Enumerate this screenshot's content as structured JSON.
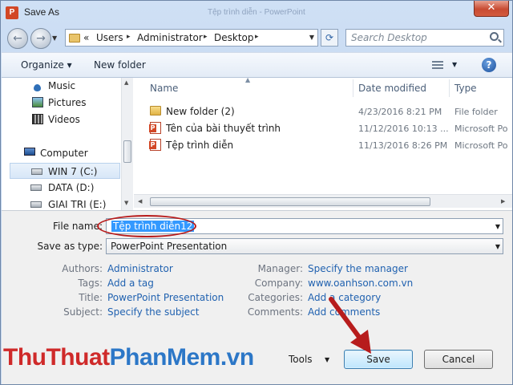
{
  "window": {
    "title": "Save As",
    "ghost_title": "Tệp trình diễn - PowerPoint",
    "close_glyph": "✕",
    "app_icon_glyph": "P"
  },
  "nav": {
    "back_glyph": "←",
    "forward_glyph": "→",
    "chevrons": "«",
    "crumbs": [
      "Users",
      "Administrator",
      "Desktop"
    ],
    "sep_glyph": "▸",
    "refresh_glyph": "⟳",
    "search_placeholder": "Search Desktop"
  },
  "toolbar": {
    "organize_label": "Organize ▾",
    "new_folder_label": "New folder",
    "help_glyph": "?"
  },
  "sidebar": {
    "items": [
      {
        "label": "Music",
        "icon": "music-icon"
      },
      {
        "label": "Pictures",
        "icon": "pictures-icon"
      },
      {
        "label": "Videos",
        "icon": "videos-icon"
      },
      {
        "label": "Computer",
        "icon": "computer-icon"
      },
      {
        "label": "WIN 7 (C:)",
        "icon": "drive-icon"
      },
      {
        "label": "DATA (D:)",
        "icon": "drive-icon"
      },
      {
        "label": "GIAI TRI (E:)",
        "icon": "drive-icon"
      }
    ]
  },
  "files": {
    "columns": [
      "Name",
      "Date modified",
      "Type"
    ],
    "rows": [
      {
        "name": "New folder (2)",
        "date": "4/23/2016 8:21 PM",
        "type": "File folder",
        "icon": "folder-icon"
      },
      {
        "name": "Tên của bài thuyết trình",
        "date": "11/12/2016 10:13 ...",
        "type": "Microsoft Po",
        "icon": "powerpoint-file-icon"
      },
      {
        "name": "Tệp trình diễn",
        "date": "11/13/2016 8:26 PM",
        "type": "Microsoft Po",
        "icon": "powerpoint-file-icon"
      }
    ]
  },
  "form": {
    "file_name_label": "File name:",
    "file_name_value": "Tệp trình diễn12",
    "save_type_label": "Save as type:",
    "save_type_value": "PowerPoint Presentation"
  },
  "meta": {
    "left": [
      {
        "label": "Authors:",
        "value": "Administrator"
      },
      {
        "label": "Tags:",
        "value": "Add a tag"
      },
      {
        "label": "Title:",
        "value": "PowerPoint Presentation"
      },
      {
        "label": "Subject:",
        "value": "Specify the subject"
      }
    ],
    "right": [
      {
        "label": "Manager:",
        "value": "Specify the manager"
      },
      {
        "label": "Company:",
        "value": "www.oanhson.com.vn"
      },
      {
        "label": "Categories:",
        "value": "Add a category"
      },
      {
        "label": "Comments:",
        "value": "Add comments"
      }
    ]
  },
  "footer": {
    "watermark_a": "ThuThuat",
    "watermark_b": "PhanMem.vn",
    "tools_label": "Tools",
    "save_label": "Save",
    "cancel_label": "Cancel"
  },
  "colors": {
    "accent_red": "#b71c1c",
    "link_blue": "#2162b0",
    "selection_blue": "#3399ff"
  }
}
